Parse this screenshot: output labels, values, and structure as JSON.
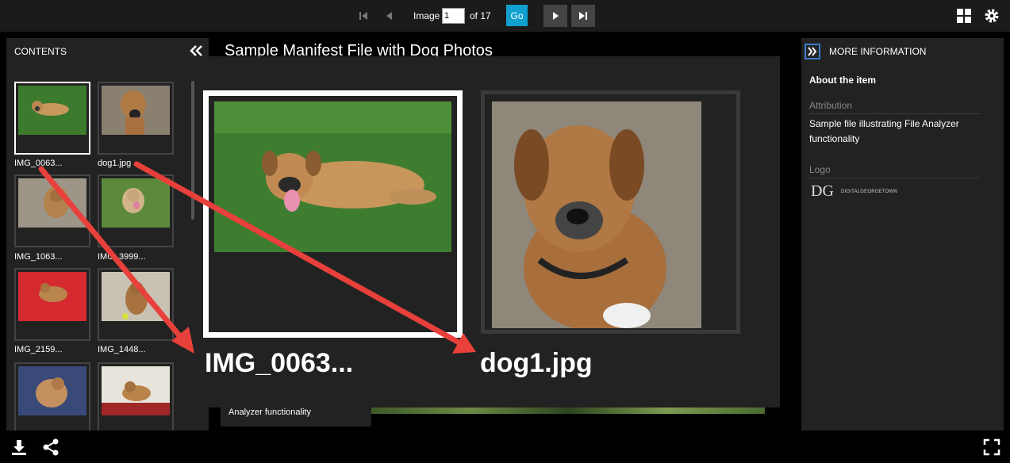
{
  "toolbar": {
    "image_label": "Image",
    "image_input_value": "1",
    "of_total": "of 17",
    "go_label": "Go",
    "icons": [
      "first-page-icon",
      "previous-icon",
      "next-icon",
      "last-page-icon",
      "gallery-view-icon",
      "settings-icon"
    ]
  },
  "contents": {
    "title": "CONTENTS",
    "items": [
      {
        "label": "IMG_0063..."
      },
      {
        "label": "dog1.jpg"
      },
      {
        "label": "IMG_1063..."
      },
      {
        "label": "IMG_3999..."
      },
      {
        "label": "IMG_2159..."
      },
      {
        "label": "IMG_1448..."
      }
    ]
  },
  "main": {
    "title": "Sample Manifest File with Dog Photos",
    "zoom_labels": [
      "IMG_0063...",
      "dog1.jpg"
    ],
    "caption_fragment": "Analyzer functionality"
  },
  "info": {
    "title": "MORE INFORMATION",
    "about": "About the item",
    "attribution_label": "Attribution",
    "attribution_value": "Sample file illustrating File Analyzer functionality",
    "logo_label": "Logo",
    "logo_text": "DG",
    "logo_subtext": "DIGITALGEORGETOWN"
  },
  "colors": {
    "accent": "#0fa0d0",
    "arrow": "#e8403a",
    "panel": "#222222",
    "topbar": "#1b1b1b"
  }
}
